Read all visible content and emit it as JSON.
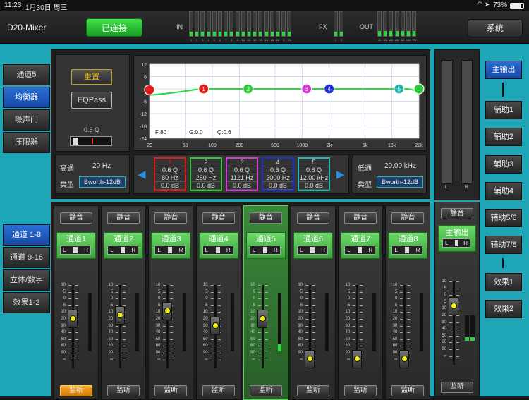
{
  "status": {
    "time": "11:23",
    "date": "1月30日 周三",
    "battery": "73%"
  },
  "header": {
    "app_name": "D20-Mixer",
    "connect_label": "已连接",
    "system_label": "系统",
    "in_label": "IN",
    "fx_label": "FX",
    "out_label": "OUT",
    "in_channels": [
      "1",
      "2",
      "3",
      "4",
      "5",
      "6",
      "7",
      "8",
      "9",
      "10",
      "11",
      "12",
      "13",
      "14",
      "15",
      "16",
      "S",
      "D"
    ],
    "in_levels": [
      0.18,
      0.18,
      0.18,
      0.18,
      0.18,
      0.18,
      0.18,
      0.18,
      0.18,
      0.18,
      0.18,
      0.18,
      0.18,
      0.18,
      0.18,
      0.18,
      0.18,
      0.18
    ],
    "fx_channels": [
      "1",
      "2"
    ],
    "fx_levels": [
      0.18,
      0.18
    ],
    "out_channels": [
      "M",
      "A1",
      "A2",
      "A3",
      "A4",
      "5/6",
      "7/8"
    ],
    "out_levels": [
      0.2,
      0.2,
      0.2,
      0.2,
      0.2,
      0.2,
      0.2
    ],
    "colors": {
      "accent": "#1ea6b7",
      "meter": "#2dd840",
      "connected": "#2fc83a"
    }
  },
  "left_tabs": [
    {
      "label": "通道5"
    },
    {
      "label": "均衡器"
    },
    {
      "label": "噪声门"
    },
    {
      "label": "压限器"
    }
  ],
  "channel_groups": [
    {
      "label": "通道 1-8"
    },
    {
      "label": "通道 9-16"
    },
    {
      "label": "立体/数字"
    },
    {
      "label": "效果1-2"
    }
  ],
  "eq": {
    "reset_label": "重置",
    "eqpass_label": "EQPass",
    "q_label": "0.6 Q",
    "y_ticks": [
      "12",
      "6",
      "0",
      "-6",
      "-12",
      "-18",
      "-24"
    ],
    "x_ticks": [
      "20",
      "50",
      "100",
      "200",
      "500",
      "1000",
      "2k",
      "5k",
      "10k",
      "20k"
    ],
    "readout": {
      "f": "F:80",
      "g": "G:0.0",
      "q": "Q:0.6"
    },
    "highpass": {
      "title": "高通",
      "freq": "20 Hz",
      "type_label": "类型",
      "type": "Bworth-12dB"
    },
    "lowpass": {
      "title": "低通",
      "freq": "20.00 kHz",
      "type_label": "类型",
      "type": "Bworth-12dB"
    },
    "bands": [
      {
        "num": "1",
        "q": "0.6 Q",
        "freq": "80 Hz",
        "gain": "0.0 dB",
        "color": "#e01c1c"
      },
      {
        "num": "2",
        "q": "0.6 Q",
        "freq": "250 Hz",
        "gain": "0.0 dB",
        "color": "#2fc83a"
      },
      {
        "num": "3",
        "q": "0.6 Q",
        "freq": "1121 Hz",
        "gain": "0.0 dB",
        "color": "#d13bd6"
      },
      {
        "num": "4",
        "q": "0.6 Q",
        "freq": "2000 Hz",
        "gain": "0.0 dB",
        "color": "#1c2fd6"
      },
      {
        "num": "5",
        "q": "0.6 Q",
        "freq": "12.00 kHz",
        "gain": "0.0 dB",
        "color": "#28b6b0"
      }
    ],
    "nodes": [
      {
        "label": "",
        "freq": 20,
        "color": "#e01c1c"
      },
      {
        "label": "1",
        "freq": 80,
        "color": "#e01c1c"
      },
      {
        "label": "2",
        "freq": 250,
        "color": "#2fc83a"
      },
      {
        "label": "3",
        "freq": 1121,
        "color": "#d13bd6"
      },
      {
        "label": "4",
        "freq": 2000,
        "color": "#1c2fd6"
      },
      {
        "label": "5",
        "freq": 12000,
        "color": "#28b6b0"
      },
      {
        "label": "",
        "freq": 20000,
        "color": "#2fc83a"
      }
    ]
  },
  "strips": [
    {
      "name": "通道1",
      "mute": "静音",
      "solo": "监听",
      "fader": 0.56,
      "solo_on": true,
      "selected": false
    },
    {
      "name": "通道2",
      "mute": "静音",
      "solo": "监听",
      "fader": 0.6,
      "solo_on": false,
      "selected": false
    },
    {
      "name": "通道3",
      "mute": "静音",
      "solo": "监听",
      "fader": 0.66,
      "solo_on": false,
      "selected": false
    },
    {
      "name": "通道4",
      "mute": "静音",
      "solo": "监听",
      "fader": 0.46,
      "solo_on": false,
      "selected": false
    },
    {
      "name": "通道5",
      "mute": "静音",
      "solo": "监听",
      "fader": 0.56,
      "solo_on": false,
      "selected": true
    },
    {
      "name": "通道6",
      "mute": "静音",
      "solo": "监听",
      "fader": 0.02,
      "solo_on": false,
      "selected": false
    },
    {
      "name": "通道7",
      "mute": "静音",
      "solo": "监听",
      "fader": 0.02,
      "solo_on": false,
      "selected": false
    },
    {
      "name": "通道8",
      "mute": "静音",
      "solo": "监听",
      "fader": 0.02,
      "solo_on": false,
      "selected": false
    }
  ],
  "fader_scale": [
    "10",
    "5",
    "0",
    "5",
    "10",
    "20",
    "30",
    "40",
    "50",
    "60",
    "90",
    "∞"
  ],
  "pan": {
    "l": "L",
    "r": "R"
  },
  "main": {
    "mute": "静音",
    "name": "主输出",
    "solo": "监听",
    "fader": 0.68,
    "meter_l": "L",
    "meter_r": "R"
  },
  "outputs": [
    {
      "label": "主输出"
    },
    {
      "label": "辅助1"
    },
    {
      "label": "辅助2"
    },
    {
      "label": "辅助3"
    },
    {
      "label": "辅助4"
    },
    {
      "label": "辅助5/6"
    },
    {
      "label": "辅助7/8"
    },
    {
      "label": "效果1"
    },
    {
      "label": "效果2"
    }
  ]
}
